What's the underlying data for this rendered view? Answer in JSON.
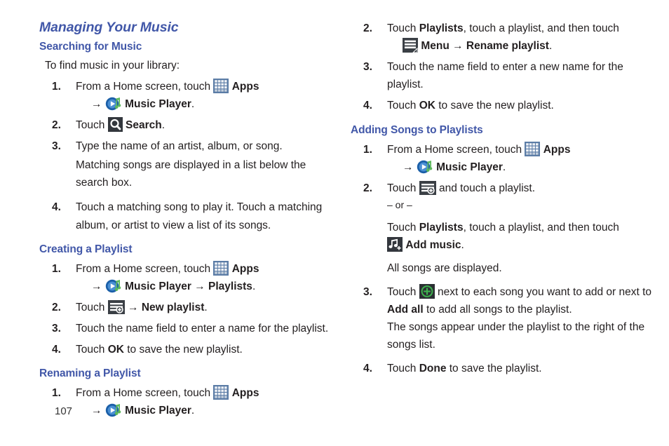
{
  "page": {
    "number": "107",
    "heading_color": "#4157a8",
    "text_color": "#231f20"
  },
  "left_column": {
    "chapter_title": "Managing Your Music",
    "sections": [
      {
        "title": "Searching for Music",
        "lead": "To find music in your library:",
        "steps": [
          {
            "num": "1.",
            "line1_a": "From a Home screen, touch",
            "icon1": "apps-grid-icon",
            "line1_b": "Apps",
            "arrow": "→",
            "icon2": "music-player-icon",
            "line2_b": "Music Player",
            "line2_c": "."
          },
          {
            "num": "2.",
            "line1_a": "Touch",
            "icon1": "search-icon",
            "line1_b": "Search",
            "line1_c": "."
          },
          {
            "num": "3.",
            "line1_a": "Type the name of an artist, album, or song.",
            "sub": "Matching songs are displayed in a list below the search box."
          },
          {
            "num": "4.",
            "line1_a": "Touch a matching song to play it. Touch a matching album, or artist to view a list of its songs."
          }
        ]
      },
      {
        "title": "Creating a Playlist",
        "steps": [
          {
            "num": "1.",
            "line1_a": "From a Home screen, touch",
            "icon1": "apps-grid-icon",
            "line1_b": "Apps",
            "arrow": "→",
            "icon2": "music-player-icon",
            "line2_b": "Music Player",
            "arrow2": "→",
            "line2_c": "Playlists",
            "line2_d": "."
          },
          {
            "num": "2.",
            "line1_a": "Touch",
            "icon1": "add-playlist-icon",
            "arrow": "→",
            "line1_b": "New playlist",
            "line1_c": "."
          },
          {
            "num": "3.",
            "line1_a": "Touch the name field to enter a name for the playlist."
          },
          {
            "num": "4.",
            "line1_a": "Touch",
            "bold": "OK",
            "line1_b": "to save the new playlist."
          }
        ]
      },
      {
        "title": "Renaming a Playlist",
        "steps": [
          {
            "num": "1.",
            "line1_a": "From a Home screen, touch",
            "icon1": "apps-grid-icon",
            "line1_b": "Apps",
            "arrow": "→",
            "icon2": "music-player-icon",
            "line2_b": "Music Player",
            "line2_c": "."
          }
        ]
      }
    ]
  },
  "right_column": {
    "sections": [
      {
        "title": "",
        "steps": [
          {
            "num": "2.",
            "line1_a": "Touch",
            "bold1": "Playlists",
            "line1_b": ", touch a playlist, and then touch",
            "icon1": "menu-icon",
            "bold2": "Menu",
            "arrow": "→",
            "bold3": "Rename playlist",
            "line1_c": "."
          },
          {
            "num": "3.",
            "line1_a": "Touch the name field to enter a new name for the playlist."
          },
          {
            "num": "4.",
            "line1_a": "Touch",
            "bold": "OK",
            "line1_b": "to save the new playlist."
          }
        ]
      },
      {
        "title": "Adding Songs to Playlists",
        "steps": [
          {
            "num": "1.",
            "line1_a": "From a Home screen, touch",
            "icon1": "apps-grid-icon",
            "line1_b": "Apps",
            "arrow": "→",
            "icon2": "music-player-icon",
            "line2_b": "Music Player",
            "line2_c": "."
          },
          {
            "num": "2.",
            "line1_a": "Touch",
            "icon1": "add-playlist-icon",
            "line1_b": "and touch a playlist.",
            "or_text": "– or –",
            "alt_a": "Touch",
            "alt_bold": "Playlists",
            "alt_b": ", touch a playlist, and then touch",
            "icon2": "add-music-icon",
            "alt_bold2": "Add music",
            "alt_c": ".",
            "note": "All songs are displayed."
          },
          {
            "num": "3.",
            "line1_a": "Touch",
            "icon1": "green-plus-icon",
            "line1_b": "next to each song you want to add or next to",
            "bold": "Add all",
            "line1_c": "to add all songs to the playlist.",
            "sub": "The songs appear under the playlist to the right of the songs list."
          },
          {
            "num": "4.",
            "line1_a": "Touch",
            "bold": "Done",
            "line1_b": "to save the playlist."
          }
        ]
      }
    ]
  }
}
